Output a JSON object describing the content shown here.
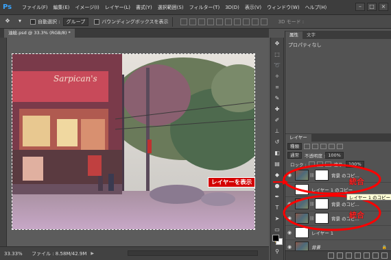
{
  "app": {
    "logo": "Ps",
    "menus": [
      "ファイル(F)",
      "編集(E)",
      "イメージ(I)",
      "レイヤー(L)",
      "書式(Y)",
      "選択範囲(S)",
      "フィルター(T)",
      "3D(D)",
      "表示(V)",
      "ウィンドウ(W)",
      "ヘルプ(H)"
    ],
    "window_controls": [
      "–",
      "□",
      "×"
    ]
  },
  "options": {
    "auto_select_label": "自動選択 :",
    "auto_select_value": "グループ",
    "bbox_label": "バウンディングボックスを表示",
    "mode_3d": "3D モード :"
  },
  "document": {
    "tab_title": "油絵.psd @ 33.3% (RGB/8) *"
  },
  "status": {
    "zoom": "33.33%",
    "file_info": "ファイル : 8.58M/42.9M"
  },
  "properties": {
    "tabs": [
      "属性",
      "文字"
    ],
    "content": "プロパティなし"
  },
  "layers": {
    "panel_title": "レイヤー",
    "filter_label": "種類",
    "blend_mode": "通常",
    "opacity_label": "不透明度 :",
    "opacity_value": "100%",
    "lock_label": "ロック :",
    "fill_label": "塗り :",
    "fill_value": "100%",
    "items": [
      {
        "name": "背景 のコピ...",
        "thumb": "photo",
        "has_mask": true
      },
      {
        "name": "レイヤー 1 のコピー",
        "thumb": "white",
        "has_mask": false
      },
      {
        "name": "背景 のコピ...",
        "thumb": "photo",
        "has_mask": true
      },
      {
        "name": "背景 のコピ...",
        "thumb": "photo",
        "has_mask": true
      },
      {
        "name": "レイヤー 1",
        "thumb": "white",
        "has_mask": false
      },
      {
        "name": "背景",
        "thumb": "photo",
        "has_mask": false
      }
    ]
  },
  "annotations": {
    "show_layer_label": "レイヤーを表示",
    "merge_label_1": "統合",
    "merge_label_2": "統合",
    "tooltip": "レイヤー 1 のコピー",
    "accent_color": "#ff0000"
  }
}
